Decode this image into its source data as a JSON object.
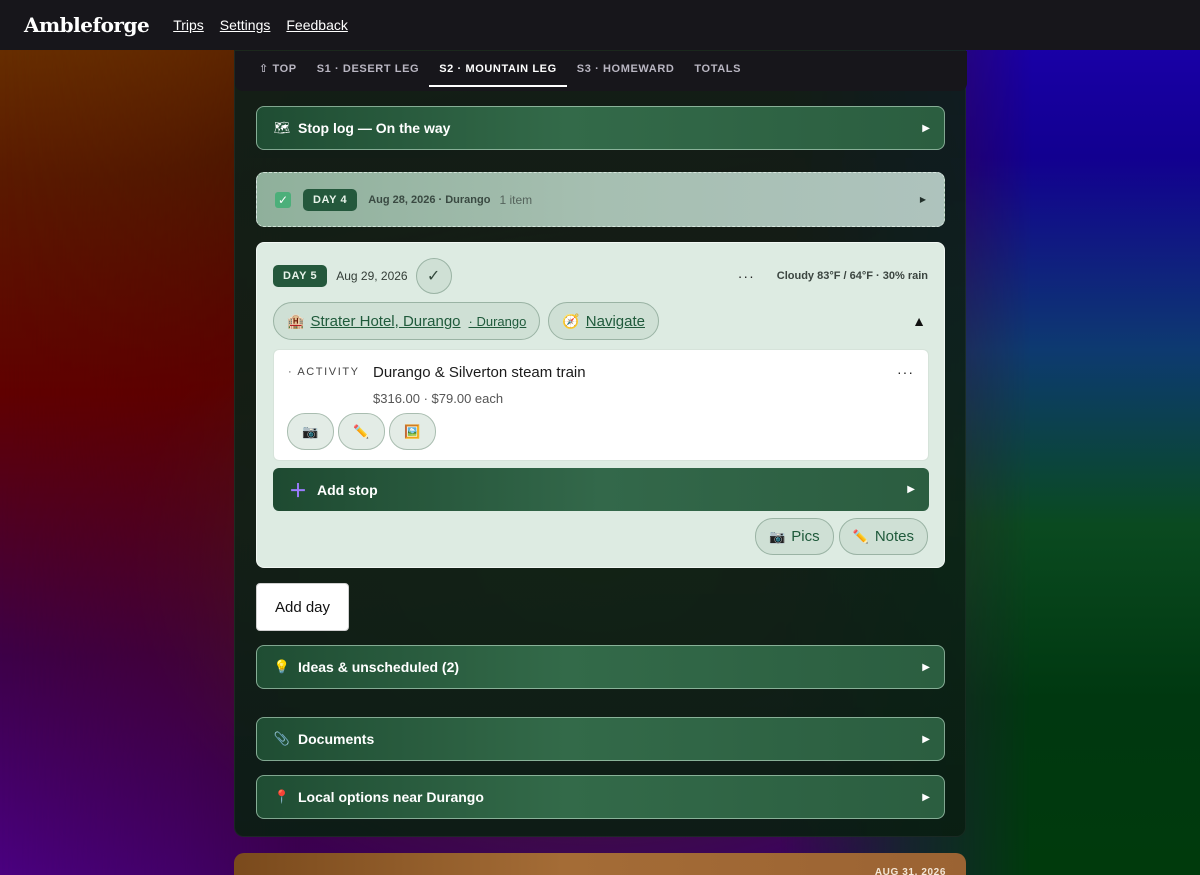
{
  "app": {
    "brand": "Ambleforge",
    "nav": [
      "Trips",
      "Settings",
      "Feedback"
    ]
  },
  "tabs": [
    {
      "label": "⇧ TOP",
      "active": false
    },
    {
      "label": "S1 · DESERT LEG",
      "active": false
    },
    {
      "label": "S2 · MOUNTAIN LEG",
      "active": true
    },
    {
      "label": "S3 · HOMEWARD",
      "active": false
    },
    {
      "label": "TOTALS",
      "active": false
    }
  ],
  "stop_log": {
    "label": "Stop log — On the way"
  },
  "day4": {
    "pill": "DAY 4",
    "date": "Aug 28, 2026 · Durango",
    "count": "1 item",
    "checked": true
  },
  "day5": {
    "pill": "DAY 5",
    "date": "Aug 29, 2026",
    "done_symbol": "✓",
    "more": "···",
    "weather": "Cloudy 83°F / 64°F · 30% rain",
    "hotel": {
      "name": "Strater Hotel, Durango",
      "sub": "· Durango"
    },
    "navigate": "Navigate",
    "collapse_symbol": "▲",
    "activity": {
      "kind": "ACTIVITY",
      "title": "Durango & Silverton steam train",
      "price": "$316.00 · $79.00 each",
      "more": "···"
    },
    "add_stop": "Add stop",
    "pics": "Pics",
    "notes": "Notes"
  },
  "add_day": "Add day",
  "sections": {
    "ideas": "Ideas & unscheduled (2)",
    "documents": "Documents",
    "local": "Local options near Durango"
  },
  "next_section": {
    "date": "AUG 31, 2026"
  },
  "colors": {
    "topbar": "#17161b",
    "accent_green": "#24583c",
    "card_bg": "#ddebe2"
  }
}
